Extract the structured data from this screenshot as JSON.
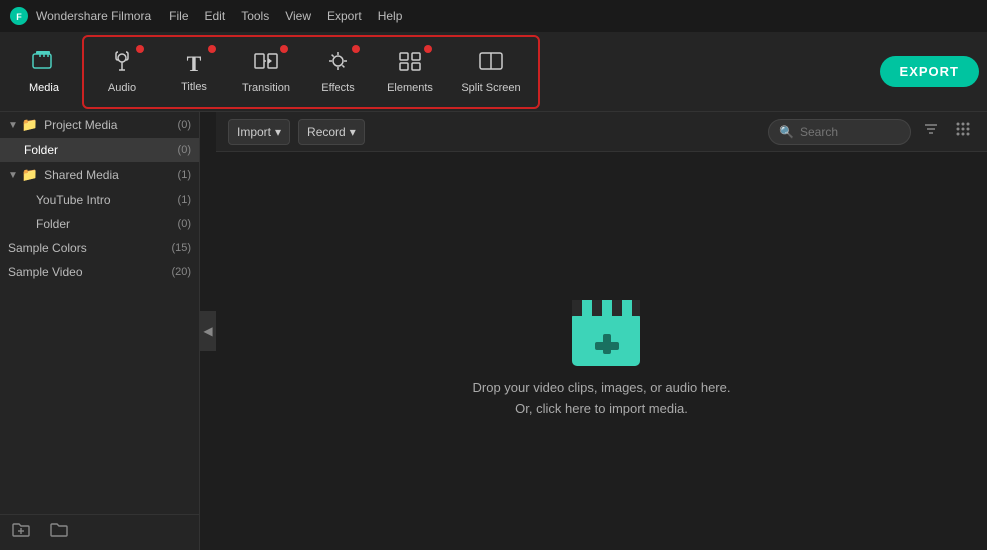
{
  "app": {
    "title": "Wondershare Filmora",
    "icon": "F"
  },
  "menubar": {
    "items": [
      "File",
      "Edit",
      "Tools",
      "View",
      "Export",
      "Help"
    ]
  },
  "toolbar": {
    "export_label": "EXPORT",
    "items": [
      {
        "id": "media",
        "label": "Media",
        "icon": "🎬",
        "active": true,
        "dot": false
      },
      {
        "id": "audio",
        "label": "Audio",
        "icon": "♪",
        "active": false,
        "dot": true
      },
      {
        "id": "titles",
        "label": "Titles",
        "icon": "T",
        "active": false,
        "dot": true
      },
      {
        "id": "transition",
        "label": "Transition",
        "icon": "↔",
        "active": false,
        "dot": true
      },
      {
        "id": "effects",
        "label": "Effects",
        "icon": "✦",
        "active": false,
        "dot": true
      },
      {
        "id": "elements",
        "label": "Elements",
        "icon": "⊞",
        "active": false,
        "dot": true
      },
      {
        "id": "split_screen",
        "label": "Split Screen",
        "icon": "⊡",
        "active": false,
        "dot": false
      }
    ],
    "outlined_group": [
      "audio",
      "titles",
      "transition",
      "effects",
      "elements",
      "split_screen"
    ]
  },
  "content_toolbar": {
    "import_label": "Import",
    "record_label": "Record",
    "search_placeholder": "Search"
  },
  "sidebar": {
    "items": [
      {
        "id": "project_media",
        "label": "Project Media",
        "count": "(0)",
        "indent": 0,
        "chevron": true,
        "folder": true,
        "selected": false
      },
      {
        "id": "folder_selected",
        "label": "Folder",
        "count": "(0)",
        "indent": 1,
        "chevron": false,
        "folder": false,
        "selected": true
      },
      {
        "id": "shared_media",
        "label": "Shared Media",
        "count": "(1)",
        "indent": 0,
        "chevron": true,
        "folder": true,
        "selected": false
      },
      {
        "id": "youtube_intro",
        "label": "YouTube Intro",
        "count": "(1)",
        "indent": 2,
        "chevron": false,
        "folder": false,
        "selected": false
      },
      {
        "id": "folder2",
        "label": "Folder",
        "count": "(0)",
        "indent": 2,
        "chevron": false,
        "folder": false,
        "selected": false
      },
      {
        "id": "sample_colors",
        "label": "Sample Colors",
        "count": "(15)",
        "indent": 0,
        "chevron": false,
        "folder": false,
        "selected": false
      },
      {
        "id": "sample_video",
        "label": "Sample Video",
        "count": "(20)",
        "indent": 0,
        "chevron": false,
        "folder": false,
        "selected": false
      }
    ],
    "footer_icons": [
      "new-folder",
      "folder"
    ]
  },
  "drop_zone": {
    "line1": "Drop your video clips, images, or audio here.",
    "line2": "Or, click here to import media."
  }
}
